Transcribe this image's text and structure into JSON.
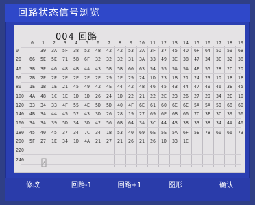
{
  "title": "回路状态信号浏览",
  "loop_title": "004 回路",
  "columns": [
    "0",
    "1",
    "2",
    "3",
    "4",
    "5",
    "6",
    "7",
    "8",
    "9",
    "10",
    "11",
    "12",
    "13",
    "14",
    "15",
    "16",
    "17",
    "18",
    "19"
  ],
  "rows": [
    {
      "label": "0",
      "values": [
        "",
        "39",
        "3A",
        "5F",
        "38",
        "52",
        "4B",
        "42",
        "42",
        "53",
        "3A",
        "3F",
        "37",
        "45",
        "4D",
        "6F",
        "64",
        "5D",
        "59",
        "6B"
      ]
    },
    {
      "label": "20",
      "values": [
        "66",
        "5E",
        "5E",
        "71",
        "5B",
        "6F",
        "32",
        "32",
        "32",
        "31",
        "3A",
        "33",
        "49",
        "3C",
        "38",
        "47",
        "34",
        "3C",
        "32",
        "38"
      ]
    },
    {
      "label": "40",
      "values": [
        "3B",
        "3E",
        "46",
        "48",
        "4B",
        "4A",
        "43",
        "5B",
        "5B",
        "60",
        "63",
        "54",
        "55",
        "5A",
        "5A",
        "4F",
        "55",
        "28",
        "2C",
        "2D"
      ]
    },
    {
      "label": "60",
      "values": [
        "2B",
        "2E",
        "2E",
        "2E",
        "2E",
        "2F",
        "2E",
        "29",
        "1E",
        "29",
        "24",
        "1D",
        "23",
        "1B",
        "21",
        "24",
        "23",
        "1D",
        "1B",
        "1B"
      ]
    },
    {
      "label": "80",
      "values": [
        "1E",
        "1B",
        "1E",
        "21",
        "45",
        "49",
        "42",
        "4E",
        "44",
        "42",
        "4B",
        "46",
        "45",
        "43",
        "44",
        "47",
        "49",
        "46",
        "3E",
        "45"
      ]
    },
    {
      "label": "100",
      "values": [
        "4A",
        "48",
        "1C",
        "1E",
        "1D",
        "1D",
        "26",
        "24",
        "1D",
        "22",
        "21",
        "22",
        "2E",
        "23",
        "26",
        "27",
        "29",
        "34",
        "2E",
        "10"
      ]
    },
    {
      "label": "120",
      "values": [
        "33",
        "34",
        "33",
        "4F",
        "55",
        "4E",
        "5D",
        "5D",
        "40",
        "4F",
        "6E",
        "61",
        "60",
        "6C",
        "6E",
        "5A",
        "5A",
        "5D",
        "68",
        "60"
      ]
    },
    {
      "label": "140",
      "values": [
        "4B",
        "3A",
        "44",
        "45",
        "52",
        "43",
        "3D",
        "26",
        "28",
        "19",
        "27",
        "69",
        "6E",
        "6B",
        "66",
        "7C",
        "3F",
        "3C",
        "39",
        "56"
      ]
    },
    {
      "label": "160",
      "values": [
        "3A",
        "3A",
        "39",
        "5D",
        "34",
        "3D",
        "42",
        "56",
        "6B",
        "64",
        "3A",
        "3C",
        "44",
        "43",
        "38",
        "33",
        "38",
        "34",
        "4A",
        "40"
      ]
    },
    {
      "label": "180",
      "values": [
        "45",
        "40",
        "45",
        "37",
        "34",
        "7C",
        "34",
        "1B",
        "53",
        "40",
        "69",
        "6E",
        "5E",
        "5A",
        "6F",
        "5E",
        "7B",
        "60",
        "66",
        "73"
      ]
    },
    {
      "label": "200",
      "values": [
        "5F",
        "27",
        "1E",
        "34",
        "1D",
        "4A",
        "21",
        "27",
        "21",
        "26",
        "21",
        "26",
        "1D",
        "33",
        "1C",
        "",
        "",
        "",
        "",
        ""
      ]
    },
    {
      "label": "220",
      "values": [
        "",
        "",
        "",
        "",
        "",
        "",
        "",
        "",
        "",
        "",
        "",
        "",
        "",
        "",
        "",
        "",
        "",
        "",
        "",
        ""
      ]
    },
    {
      "label": "240",
      "values": [
        "",
        "",
        "",
        "",
        "",
        "",
        "",
        "",
        "",
        "",
        "",
        "",
        "",
        "",
        "",
        "",
        "",
        "",
        "",
        ""
      ]
    }
  ],
  "buttons": {
    "modify": "修改",
    "prev": "回路-1",
    "next": "回路+1",
    "graph": "图形",
    "confirm": "确认"
  }
}
